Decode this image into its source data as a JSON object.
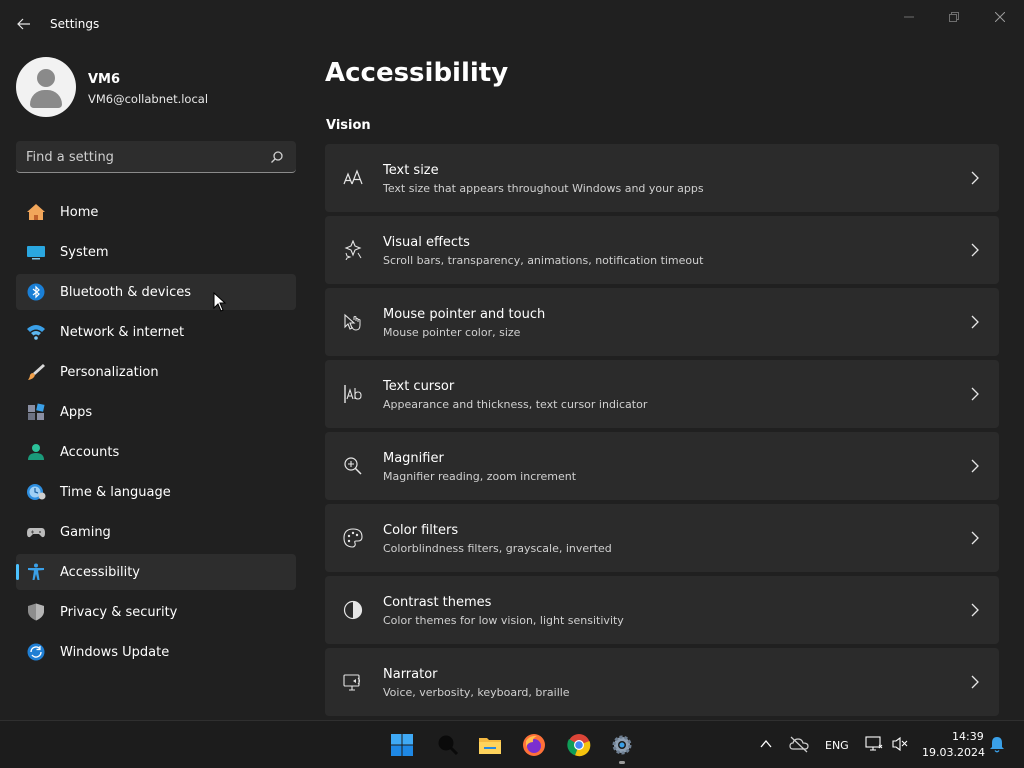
{
  "window": {
    "title": "Settings",
    "controls": {
      "minimize": "minimize-icon",
      "maximize": "maximize-icon",
      "close": "close-icon"
    }
  },
  "profile": {
    "name": "VM6",
    "email": "VM6@collabnet.local"
  },
  "search": {
    "placeholder": "Find a setting"
  },
  "sidebar": {
    "items": [
      {
        "label": "Home",
        "icon": "home-icon"
      },
      {
        "label": "System",
        "icon": "system-icon"
      },
      {
        "label": "Bluetooth & devices",
        "icon": "bluetooth-icon"
      },
      {
        "label": "Network & internet",
        "icon": "wifi-icon"
      },
      {
        "label": "Personalization",
        "icon": "brush-icon"
      },
      {
        "label": "Apps",
        "icon": "apps-icon"
      },
      {
        "label": "Accounts",
        "icon": "accounts-icon"
      },
      {
        "label": "Time & language",
        "icon": "time-language-icon"
      },
      {
        "label": "Gaming",
        "icon": "gamepad-icon"
      },
      {
        "label": "Accessibility",
        "icon": "accessibility-icon"
      },
      {
        "label": "Privacy & security",
        "icon": "shield-icon"
      },
      {
        "label": "Windows Update",
        "icon": "update-icon"
      }
    ],
    "selected": "Accessibility",
    "hovered": "Bluetooth & devices",
    "accent": "#4cc2ff"
  },
  "main": {
    "title": "Accessibility",
    "section": "Vision",
    "cards": [
      {
        "title": "Text size",
        "desc": "Text size that appears throughout Windows and your apps",
        "icon": "text-size-icon"
      },
      {
        "title": "Visual effects",
        "desc": "Scroll bars, transparency, animations, notification timeout",
        "icon": "visual-effects-icon"
      },
      {
        "title": "Mouse pointer and touch",
        "desc": "Mouse pointer color, size",
        "icon": "mouse-pointer-icon"
      },
      {
        "title": "Text cursor",
        "desc": "Appearance and thickness, text cursor indicator",
        "icon": "text-cursor-icon"
      },
      {
        "title": "Magnifier",
        "desc": "Magnifier reading, zoom increment",
        "icon": "magnifier-icon"
      },
      {
        "title": "Color filters",
        "desc": "Colorblindness filters, grayscale, inverted",
        "icon": "palette-icon"
      },
      {
        "title": "Contrast themes",
        "desc": "Color themes for low vision, light sensitivity",
        "icon": "contrast-icon"
      },
      {
        "title": "Narrator",
        "desc": "Voice, verbosity, keyboard, braille",
        "icon": "narrator-icon"
      }
    ]
  },
  "taskbar": {
    "apps": [
      "windows-start-icon",
      "search-icon",
      "file-explorer-icon",
      "firefox-icon",
      "chrome-icon",
      "settings-gear-icon"
    ],
    "tray": {
      "language": "ENG",
      "time": "14:39",
      "date": "19.03.2024"
    }
  }
}
